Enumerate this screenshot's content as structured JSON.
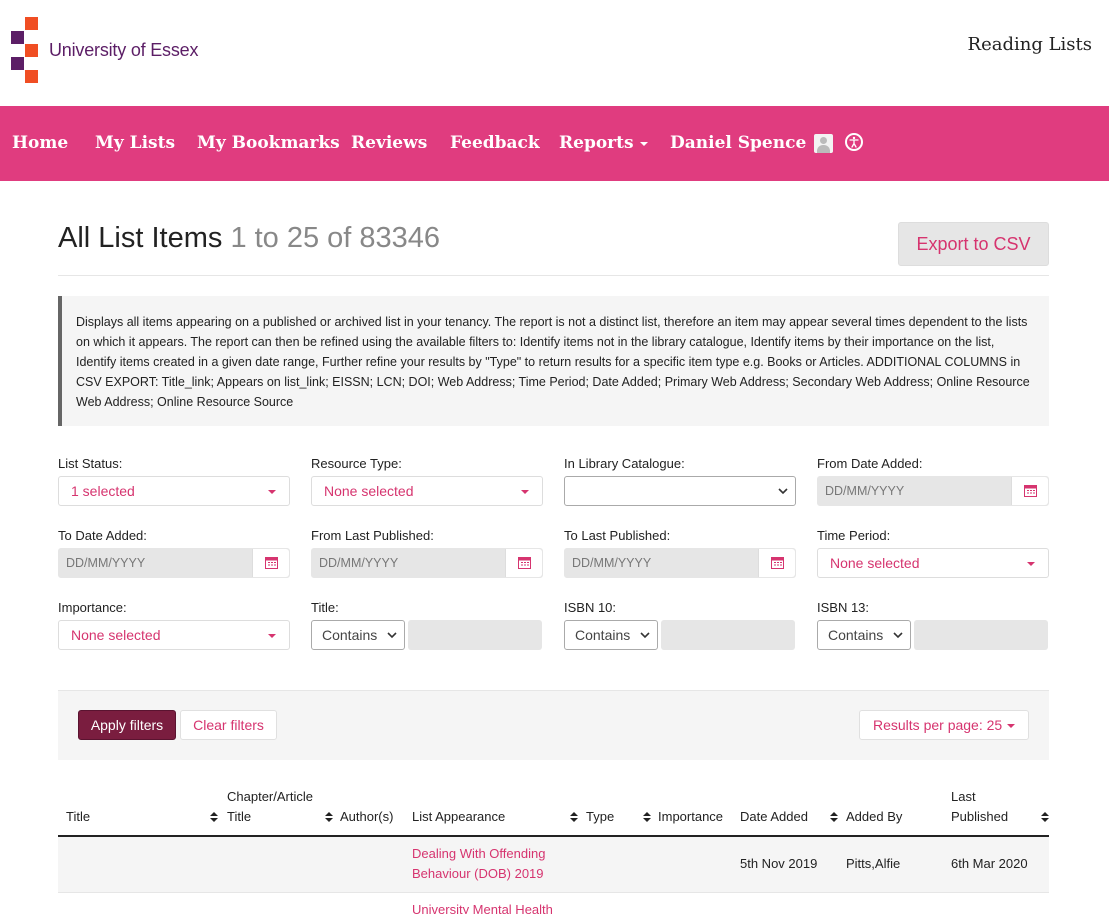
{
  "header": {
    "logo_text": "University of Essex",
    "app_title": "Reading Lists",
    "logo_colors": {
      "purple": "#5c1e66",
      "orange": "#f04e23"
    }
  },
  "nav": {
    "items": [
      "Home",
      "My Lists",
      "My Bookmarks",
      "Reviews",
      "Feedback"
    ],
    "reports_label": "Reports",
    "user_name": "Daniel Spence",
    "background": "#e03c7f"
  },
  "page": {
    "title": "All List Items",
    "range": "1 to 25 of 83346",
    "export_label": "Export to CSV",
    "description": "Displays all items appearing on a published or archived list in your tenancy. The report is not a distinct list, therefore an item may appear several times dependent to the lists on which it appears. The report can then be refined using the available filters to: Identify items not in the library catalogue, Identify items by their importance on the list, Identify items created in a given date range, Further refine your results by \"Type\" to return results for a specific item type e.g. Books or Articles. ADDITIONAL COLUMNS in CSV EXPORT: Title_link; Appears on list_link; EISSN; LCN; DOI; Web Address; Time Period; Date Added; Primary Web Address; Secondary Web Address; Online Resource Web Address; Online Resource Source"
  },
  "filters": {
    "list_status": {
      "label": "List Status:",
      "value": "1 selected"
    },
    "resource_type": {
      "label": "Resource Type:",
      "value": "None selected"
    },
    "in_library": {
      "label": "In Library Catalogue:",
      "value": ""
    },
    "from_date_added": {
      "label": "From Date Added:",
      "placeholder": "DD/MM/YYYY"
    },
    "to_date_added": {
      "label": "To Date Added:",
      "placeholder": "DD/MM/YYYY"
    },
    "from_last_published": {
      "label": "From Last Published:",
      "placeholder": "DD/MM/YYYY"
    },
    "to_last_published": {
      "label": "To Last Published:",
      "placeholder": "DD/MM/YYYY"
    },
    "time_period": {
      "label": "Time Period:",
      "value": "None selected"
    },
    "importance": {
      "label": "Importance:",
      "value": "None selected"
    },
    "title": {
      "label": "Title:",
      "operator": "Contains"
    },
    "isbn10": {
      "label": "ISBN 10:",
      "operator": "Contains"
    },
    "isbn13": {
      "label": "ISBN 13:",
      "operator": "Contains"
    }
  },
  "actions": {
    "apply": "Apply filters",
    "clear": "Clear filters",
    "results_per_page": "Results per page: 25"
  },
  "table": {
    "headers": {
      "title": "Title",
      "chapter_line1": "Chapter/Article",
      "chapter_line2": "Title",
      "authors": "Author(s)",
      "list_appearance": "List Appearance",
      "type": "Type",
      "importance": "Importance",
      "date_added": "Date Added",
      "added_by": "Added By",
      "last_line1": "Last",
      "last_line2": "Published"
    },
    "rows": [
      {
        "list_line1": "Dealing With Offending",
        "list_line2": "Behaviour (DOB) 2019",
        "date_added": "5th Nov 2019",
        "added_by": "Pitts,Alfie",
        "last_published": "6th Mar 2020"
      },
      {
        "list_line1": "University Mental Health"
      }
    ]
  }
}
